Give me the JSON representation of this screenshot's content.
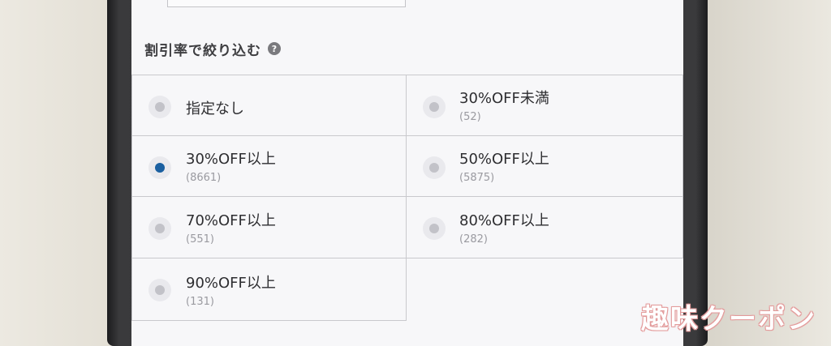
{
  "section": {
    "title": "割引率で絞り込む",
    "help_icon": "question-circle-icon",
    "help_glyph": "?"
  },
  "options": [
    {
      "label": "指定なし",
      "count": "",
      "selected": false
    },
    {
      "label": "30%OFF未満",
      "count": "(52)",
      "selected": false
    },
    {
      "label": "30%OFF以上",
      "count": "(8661)",
      "selected": true
    },
    {
      "label": "50%OFF以上",
      "count": "(5875)",
      "selected": false
    },
    {
      "label": "70%OFF以上",
      "count": "(551)",
      "selected": false
    },
    {
      "label": "80%OFF以上",
      "count": "(282)",
      "selected": false
    },
    {
      "label": "90%OFF以上",
      "count": "(131)",
      "selected": false
    }
  ],
  "watermark": {
    "text": "趣味クーポン"
  },
  "colors": {
    "accent": "#1a5fa0",
    "radio_off": "#c2c2c8",
    "border": "#c9c9cd"
  }
}
